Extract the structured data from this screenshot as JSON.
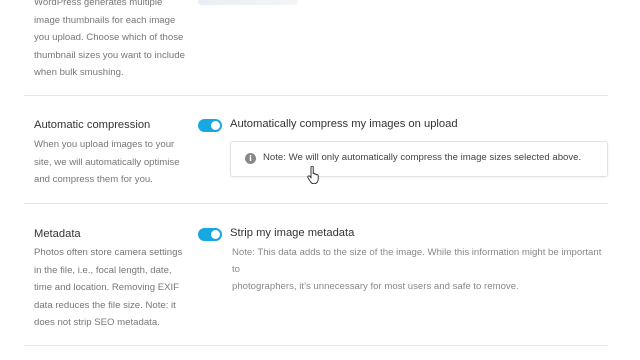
{
  "thumbnails": {
    "description_lines": [
      "WordPress generates multiple",
      "image thumbnails for each image",
      "you upload. Choose which of those",
      "thumbnail sizes you want to include",
      "when bulk smushing."
    ]
  },
  "auto_compression": {
    "title": "Automatic compression",
    "description_lines": [
      "When you upload images to your",
      "site, we will automatically optimise",
      "and compress them for you."
    ],
    "toggle_label": "Automatically compress my images on upload",
    "toggle_on": true,
    "notice_icon": "info-icon",
    "notice_text": "Note: We will only automatically compress the image sizes selected above."
  },
  "metadata": {
    "title": "Metadata",
    "description_lines": [
      "Photos often store camera settings",
      "in the file, i.e., focal length, date,",
      "time and location. Removing EXIF",
      "data reduces the file size. Note: it",
      "does not strip SEO metadata."
    ],
    "toggle_label": "Strip my image metadata",
    "toggle_on": true,
    "helper_lines": [
      "Note: This data adds to the size of the image. While this information might be important to",
      "photographers, it’s unnecessary for most users and safe to remove."
    ]
  },
  "colors": {
    "toggle_on": "#17a8e3",
    "divider": "#e6e6e6",
    "muted_text": "#777777"
  }
}
